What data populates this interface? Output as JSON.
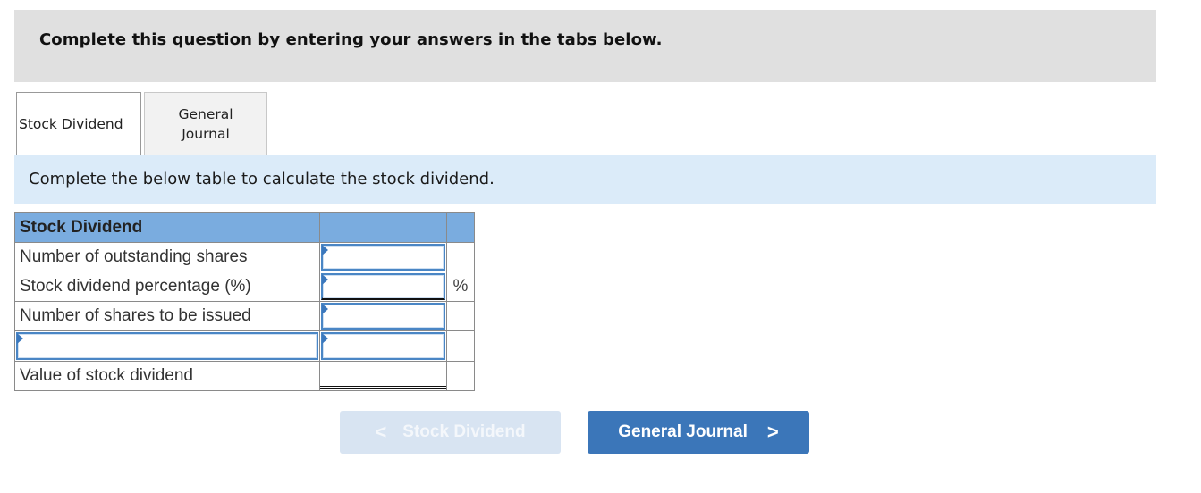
{
  "header": {
    "title": "Complete this question by entering your answers in the tabs below."
  },
  "tabs": [
    {
      "label": "Stock Dividend",
      "active": true
    },
    {
      "label_line1": "General",
      "label_line2": "Journal",
      "label": "General Journal",
      "active": false
    }
  ],
  "instruction": "Complete the below table to calculate the stock dividend.",
  "table": {
    "header_label": "Stock Dividend",
    "rows": [
      {
        "label": "Number of outstanding shares",
        "value": "",
        "unit": ""
      },
      {
        "label": "Stock dividend percentage (%)",
        "value": "",
        "unit": "%"
      },
      {
        "label": "Number of shares to be issued",
        "value": "",
        "unit": ""
      },
      {
        "label": "",
        "value": "",
        "unit": ""
      },
      {
        "label": "Value of stock dividend",
        "value": "",
        "unit": ""
      }
    ]
  },
  "buttons": {
    "prev": {
      "label": "Stock Dividend",
      "icon": "chevron-left-icon",
      "glyph": "<",
      "enabled": false
    },
    "next": {
      "label": "General Journal",
      "icon": "chevron-right-icon",
      "glyph": ">",
      "enabled": true
    }
  },
  "colors": {
    "header_bg": "#e0e0e0",
    "instruction_bg": "#dbebf9",
    "table_header_bg": "#7aacdf",
    "input_border": "#4a86c5",
    "button_primary": "#3b76b9",
    "button_disabled": "#d8e4f2"
  }
}
